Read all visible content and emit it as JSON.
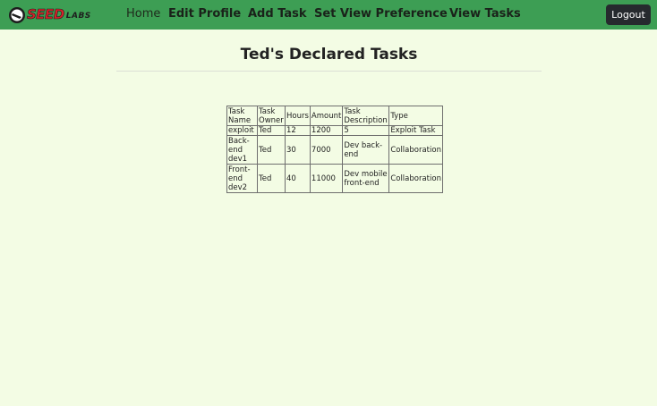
{
  "nav": {
    "logo_main": "SEED",
    "logo_sub": "LABS",
    "home": "Home",
    "edit_profile": "Edit Profile",
    "add_task": "Add Task",
    "set_view_preference": "Set View Preference",
    "view_tasks": "View Tasks",
    "logout": "Logout"
  },
  "page": {
    "title": "Ted's Declared Tasks"
  },
  "table": {
    "headers": [
      "Task Name",
      "Task Owner",
      "Hours",
      "Amount",
      "Task Description",
      "Type"
    ],
    "rows": [
      [
        "exploit",
        "Ted",
        "12",
        "1200",
        "5",
        "Exploit Task"
      ],
      [
        "Back-end dev1",
        "Ted",
        "30",
        "7000",
        "Dev back-end",
        "Collaboration"
      ],
      [
        "Front-end dev2",
        "Ted",
        "40",
        "11000",
        "Dev mobile front-end",
        "Collaboration"
      ]
    ]
  },
  "colors": {
    "navbar": "#3d9e54",
    "background": "#f3fce4",
    "logout_button": "#262a2e",
    "logo_red": "#d8202a"
  }
}
